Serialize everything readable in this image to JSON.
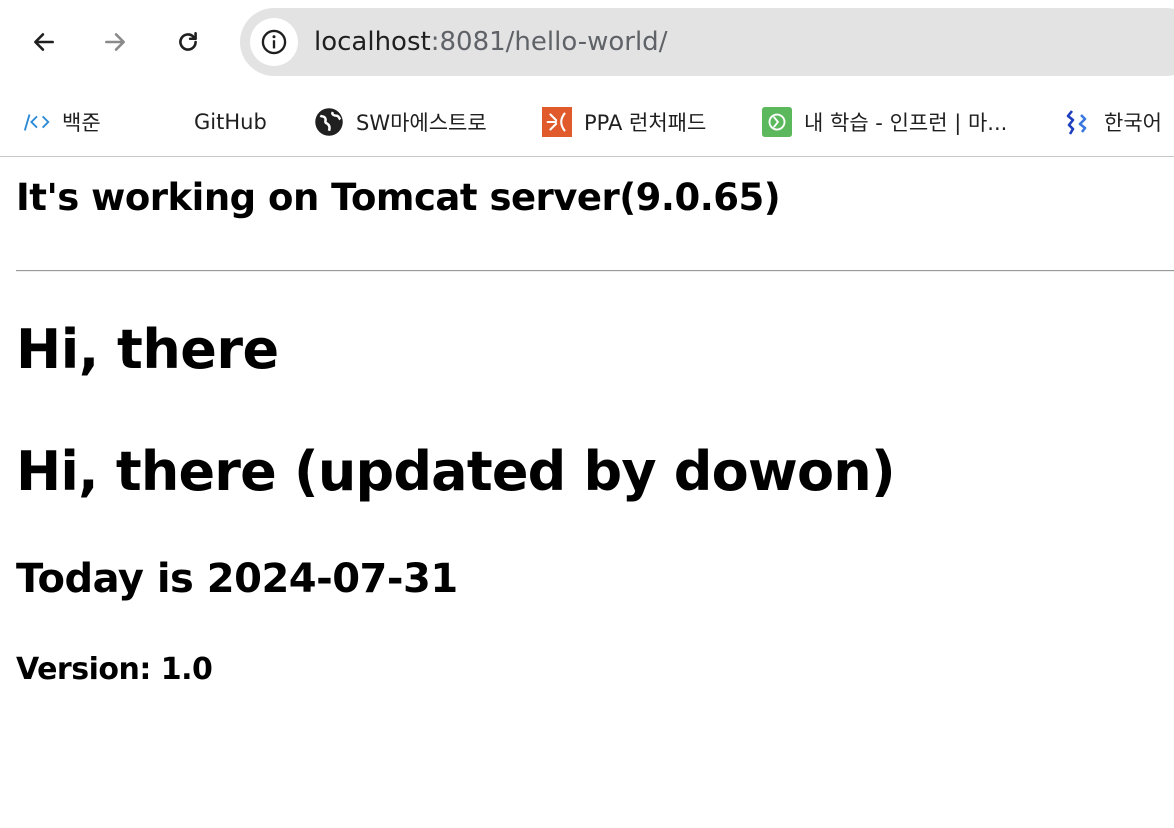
{
  "browser": {
    "url_host": "localhost",
    "url_rest": ":8081/hello-world/",
    "icons": {
      "back": "arrow-left-icon",
      "forward": "arrow-right-icon",
      "reload": "reload-icon",
      "site_info": "info-circle-icon"
    }
  },
  "bookmarks": [
    {
      "label": "백준",
      "icon": "code-brackets-icon",
      "color": "#2b8ad6"
    },
    {
      "label": "GitHub",
      "icon": "github-icon",
      "color": "#000000"
    },
    {
      "label": "SW마에스트로",
      "icon": "globe-icon",
      "color": "#202020"
    },
    {
      "label": "PPA 런처패드",
      "icon": "launchpad-icon",
      "color": "#e05a2b"
    },
    {
      "label": "내 학습 - 인프런 | 마...",
      "icon": "inflearn-icon",
      "color": "#5cb85c"
    },
    {
      "label": "한국어",
      "icon": "translate-icon",
      "color": "#1f3fbf"
    }
  ],
  "page": {
    "server_heading": "It's working on Tomcat server(9.0.65)",
    "greeting": "Hi, there",
    "greeting_updated": "Hi, there (updated by dowon)",
    "today": "Today is 2024-07-31",
    "version": "Version: 1.0"
  }
}
